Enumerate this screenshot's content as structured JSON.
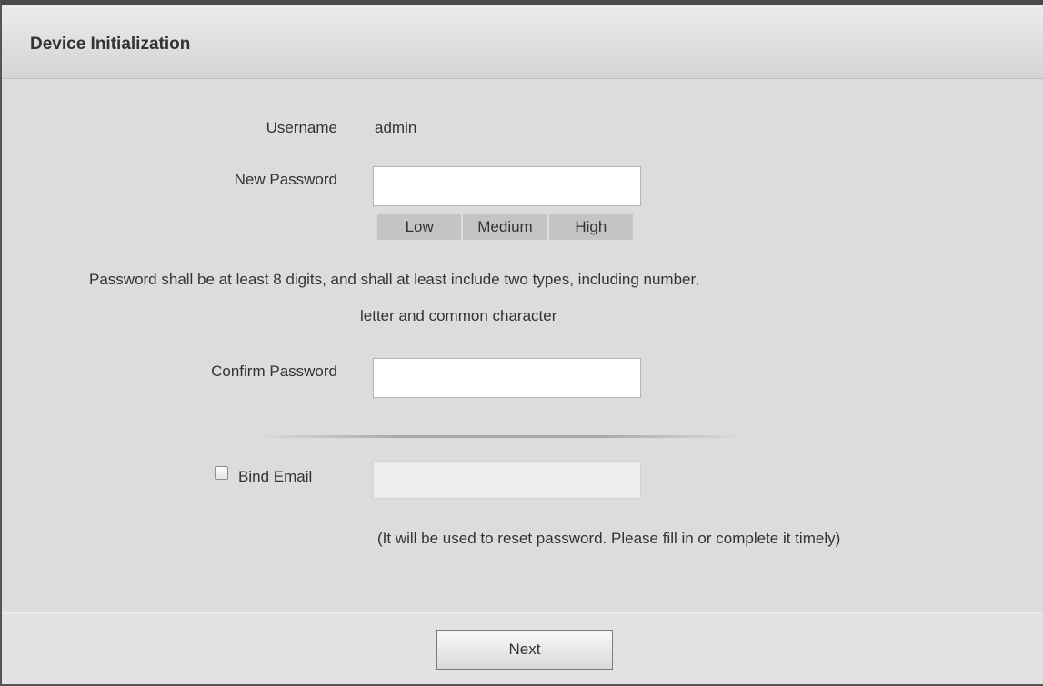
{
  "dialog": {
    "title": "Device Initialization"
  },
  "form": {
    "username_label": "Username",
    "username_value": "admin",
    "new_password_label": "New Password",
    "new_password_value": "",
    "strength_levels": [
      "Low",
      "Medium",
      "High"
    ],
    "password_hint_line1": "Password shall be at least 8 digits, and shall at least include two types, including number,",
    "password_hint_line2": "letter and common character",
    "confirm_password_label": "Confirm Password",
    "confirm_password_value": "",
    "bind_email_label": "Bind Email",
    "bind_email_checked": false,
    "email_value": "",
    "email_hint": "(It will be used to reset password. Please fill in or complete it timely)"
  },
  "footer": {
    "next_label": "Next"
  },
  "icons": {
    "checkbox": "checkbox-unchecked-icon"
  }
}
